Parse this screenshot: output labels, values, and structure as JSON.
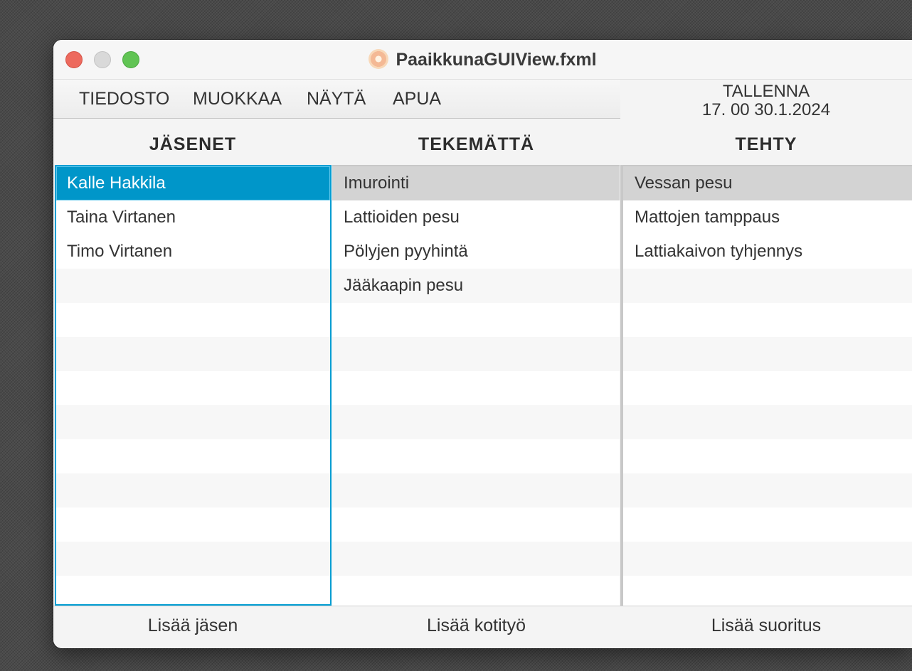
{
  "window": {
    "title": "PaaikkunaGUIView.fxml",
    "traffic_lights": [
      "close",
      "minimize",
      "zoom"
    ]
  },
  "menu": {
    "items": [
      "TIEDOSTO",
      "MUOKKAA",
      "NÄYTÄ",
      "APUA"
    ]
  },
  "save": {
    "label": "TALLENNA",
    "timestamp": "17. 00 30.1.2024"
  },
  "columns": {
    "members": "JÄSENET",
    "todo": "TEKEMÄTTÄ",
    "done": "TEHTY"
  },
  "lists": {
    "members": [
      "Kalle Hakkila",
      "Taina Virtanen",
      "Timo Virtanen"
    ],
    "todo": [
      "Imurointi",
      "Lattioiden pesu",
      "Pölyjen pyyhintä",
      "Jääkaapin pesu"
    ],
    "done": [
      "Vessan pesu",
      "Mattojen tamppaus",
      "Lattiakaivon tyhjennys"
    ],
    "selected_member": "Kalle Hakkila"
  },
  "buttons": {
    "add_member": "Lisää jäsen",
    "add_chore": "Lisää kotityö",
    "add_done": "Lisää suoritus"
  },
  "colors": {
    "selection": "#0096c9",
    "focus_border": "#039ed3",
    "highlight_row": "#d3d3d3"
  }
}
